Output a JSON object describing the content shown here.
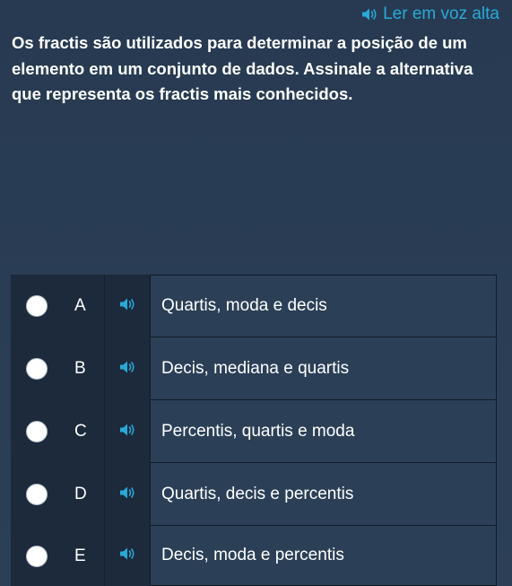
{
  "read_aloud": {
    "label": "Ler em voz alta",
    "icon": "speaker-icon",
    "color": "#29a9d8"
  },
  "question": {
    "text": "Os fractis são utilizados para determinar a posição de um elemento em um conjunto de dados. Assinale a alternativa que representa os fractis mais conhecidos."
  },
  "options": [
    {
      "letter": "A",
      "text": "Quartis, moda e decis"
    },
    {
      "letter": "B",
      "text": "Decis, mediana e quartis"
    },
    {
      "letter": "C",
      "text": "Percentis, quartis e moda"
    },
    {
      "letter": "D",
      "text": "Quartis, decis e percentis"
    },
    {
      "letter": "E",
      "text": "Decis, moda e percentis"
    }
  ],
  "colors": {
    "background": "#273a52",
    "panel_dark": "#1c2a3c",
    "accent": "#29a9d8",
    "text": "#ffffff"
  }
}
